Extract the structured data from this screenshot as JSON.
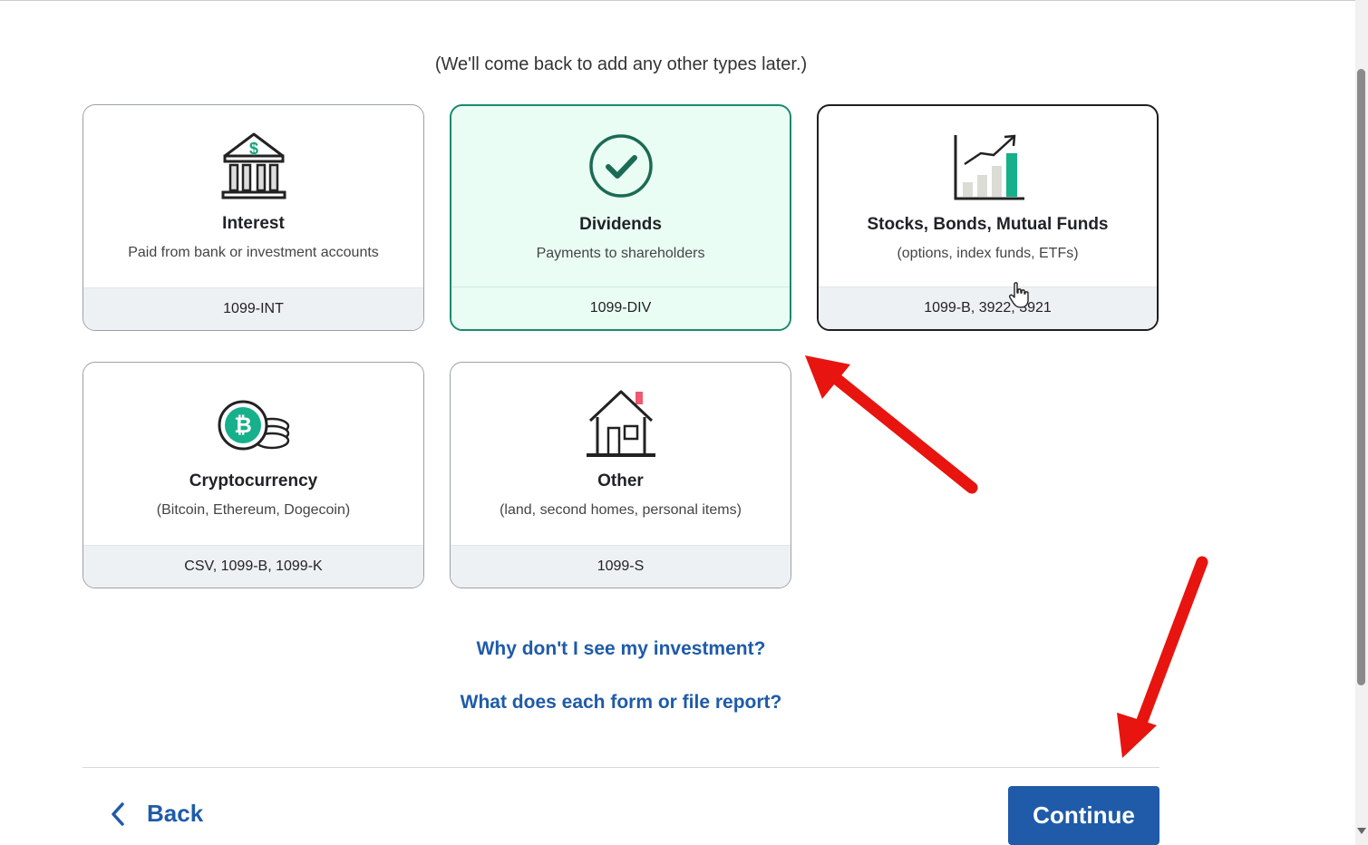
{
  "subtitle": "(We'll come back to add any other types later.)",
  "cards": [
    {
      "title": "Interest",
      "description": "Paid from bank or investment accounts",
      "forms": "1099-INT",
      "icon": "bank-icon",
      "selected": false
    },
    {
      "title": "Dividends",
      "description": "Payments to shareholders",
      "forms": "1099-DIV",
      "icon": "checkmark-circle-icon",
      "selected": true
    },
    {
      "title": "Stocks, Bonds, Mutual Funds",
      "description": "(options, index funds, ETFs)",
      "forms": "1099-B, 3922, 3921",
      "icon": "growth-chart-icon",
      "selected": false
    },
    {
      "title": "Cryptocurrency",
      "description": "(Bitcoin, Ethereum, Dogecoin)",
      "forms": "CSV, 1099-B, 1099-K",
      "icon": "bitcoin-coins-icon",
      "selected": false
    },
    {
      "title": "Other",
      "description": "(land, second homes, personal items)",
      "forms": "1099-S",
      "icon": "house-icon",
      "selected": false
    }
  ],
  "links": {
    "why_investment": "Why don't I see my investment?",
    "form_report": "What does each form or file report?"
  },
  "footer": {
    "back_label": "Back",
    "continue_label": "Continue"
  },
  "colors": {
    "accent": "#1f5ba8",
    "selected_border": "#1b8a6b",
    "selected_bg": "#e9fdf4",
    "annotation_arrow": "#e8140f"
  }
}
